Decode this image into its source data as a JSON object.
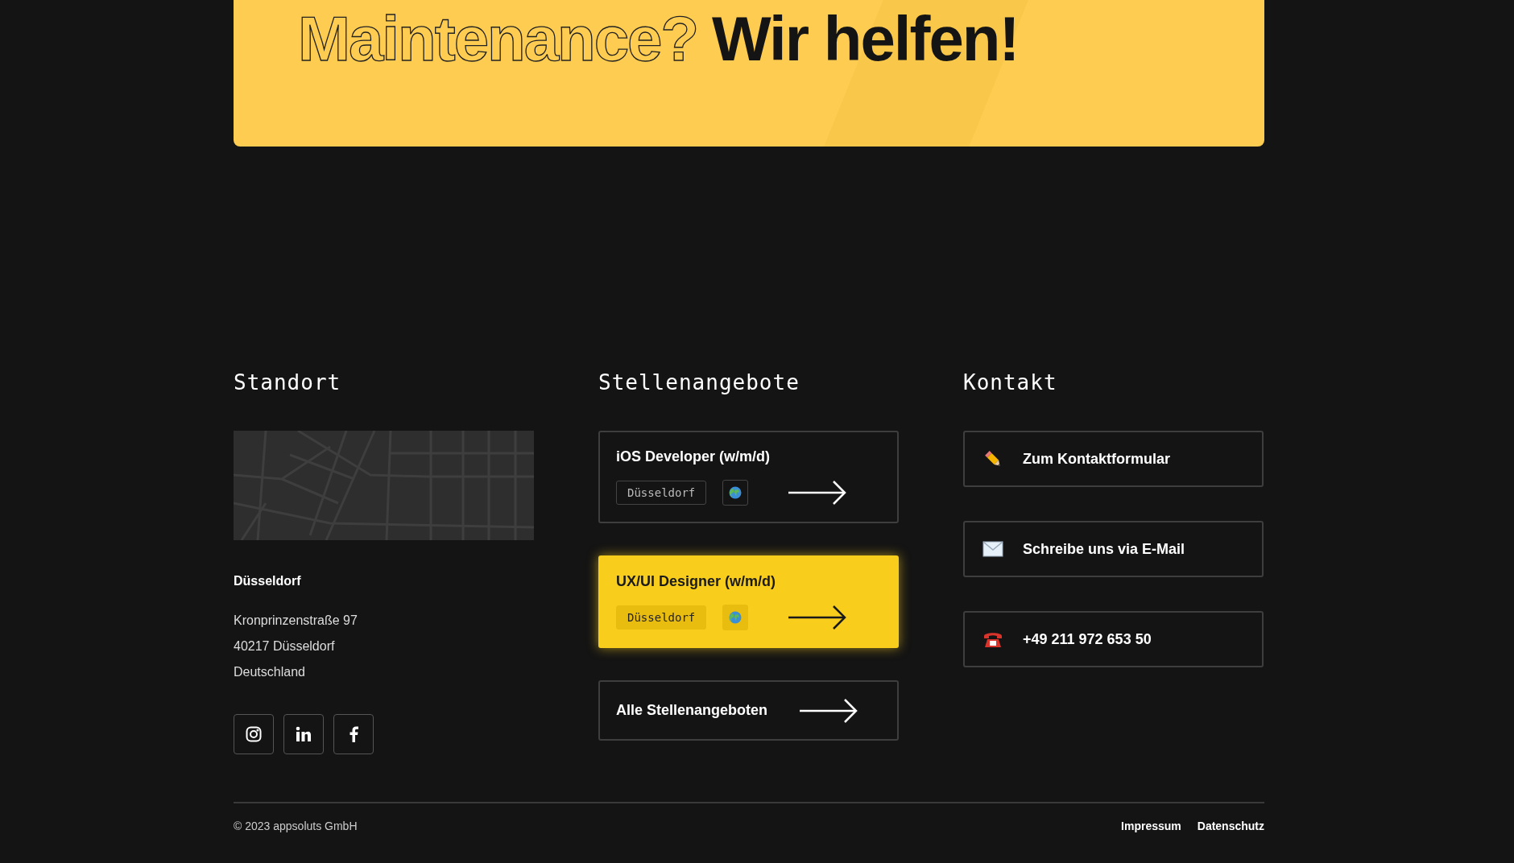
{
  "banner": {
    "outlined_text": "Maintenance?",
    "bold_text": "Wir helfen!"
  },
  "location": {
    "heading": "Standort",
    "city": "Düsseldorf",
    "address_lines": [
      "Kronprinzenstraße 97",
      "40217 Düsseldorf",
      "Deutschland"
    ],
    "social": [
      {
        "kind": "instagram"
      },
      {
        "kind": "linkedin"
      },
      {
        "kind": "facebook"
      }
    ]
  },
  "jobs": {
    "heading": "Stellenangebote",
    "items": [
      {
        "title": "iOS Developer (w/m/d)",
        "location": "Düsseldorf",
        "selected": false
      },
      {
        "title": "UX/UI Designer (w/m/d)",
        "location": "Düsseldorf",
        "selected": true
      }
    ],
    "all_link": "Alle Stellenangeboten"
  },
  "contact": {
    "heading": "Kontakt",
    "items": [
      {
        "kind": "form",
        "label": "Zum Kontaktformular"
      },
      {
        "kind": "email",
        "label": "Schreibe uns via E-Mail"
      },
      {
        "kind": "phone",
        "label": "+49 211 972 653 50"
      }
    ]
  },
  "footer": {
    "copyright": "© 2023 appsoluts GmbH",
    "links": [
      "Impressum",
      "Datenschutz"
    ]
  }
}
